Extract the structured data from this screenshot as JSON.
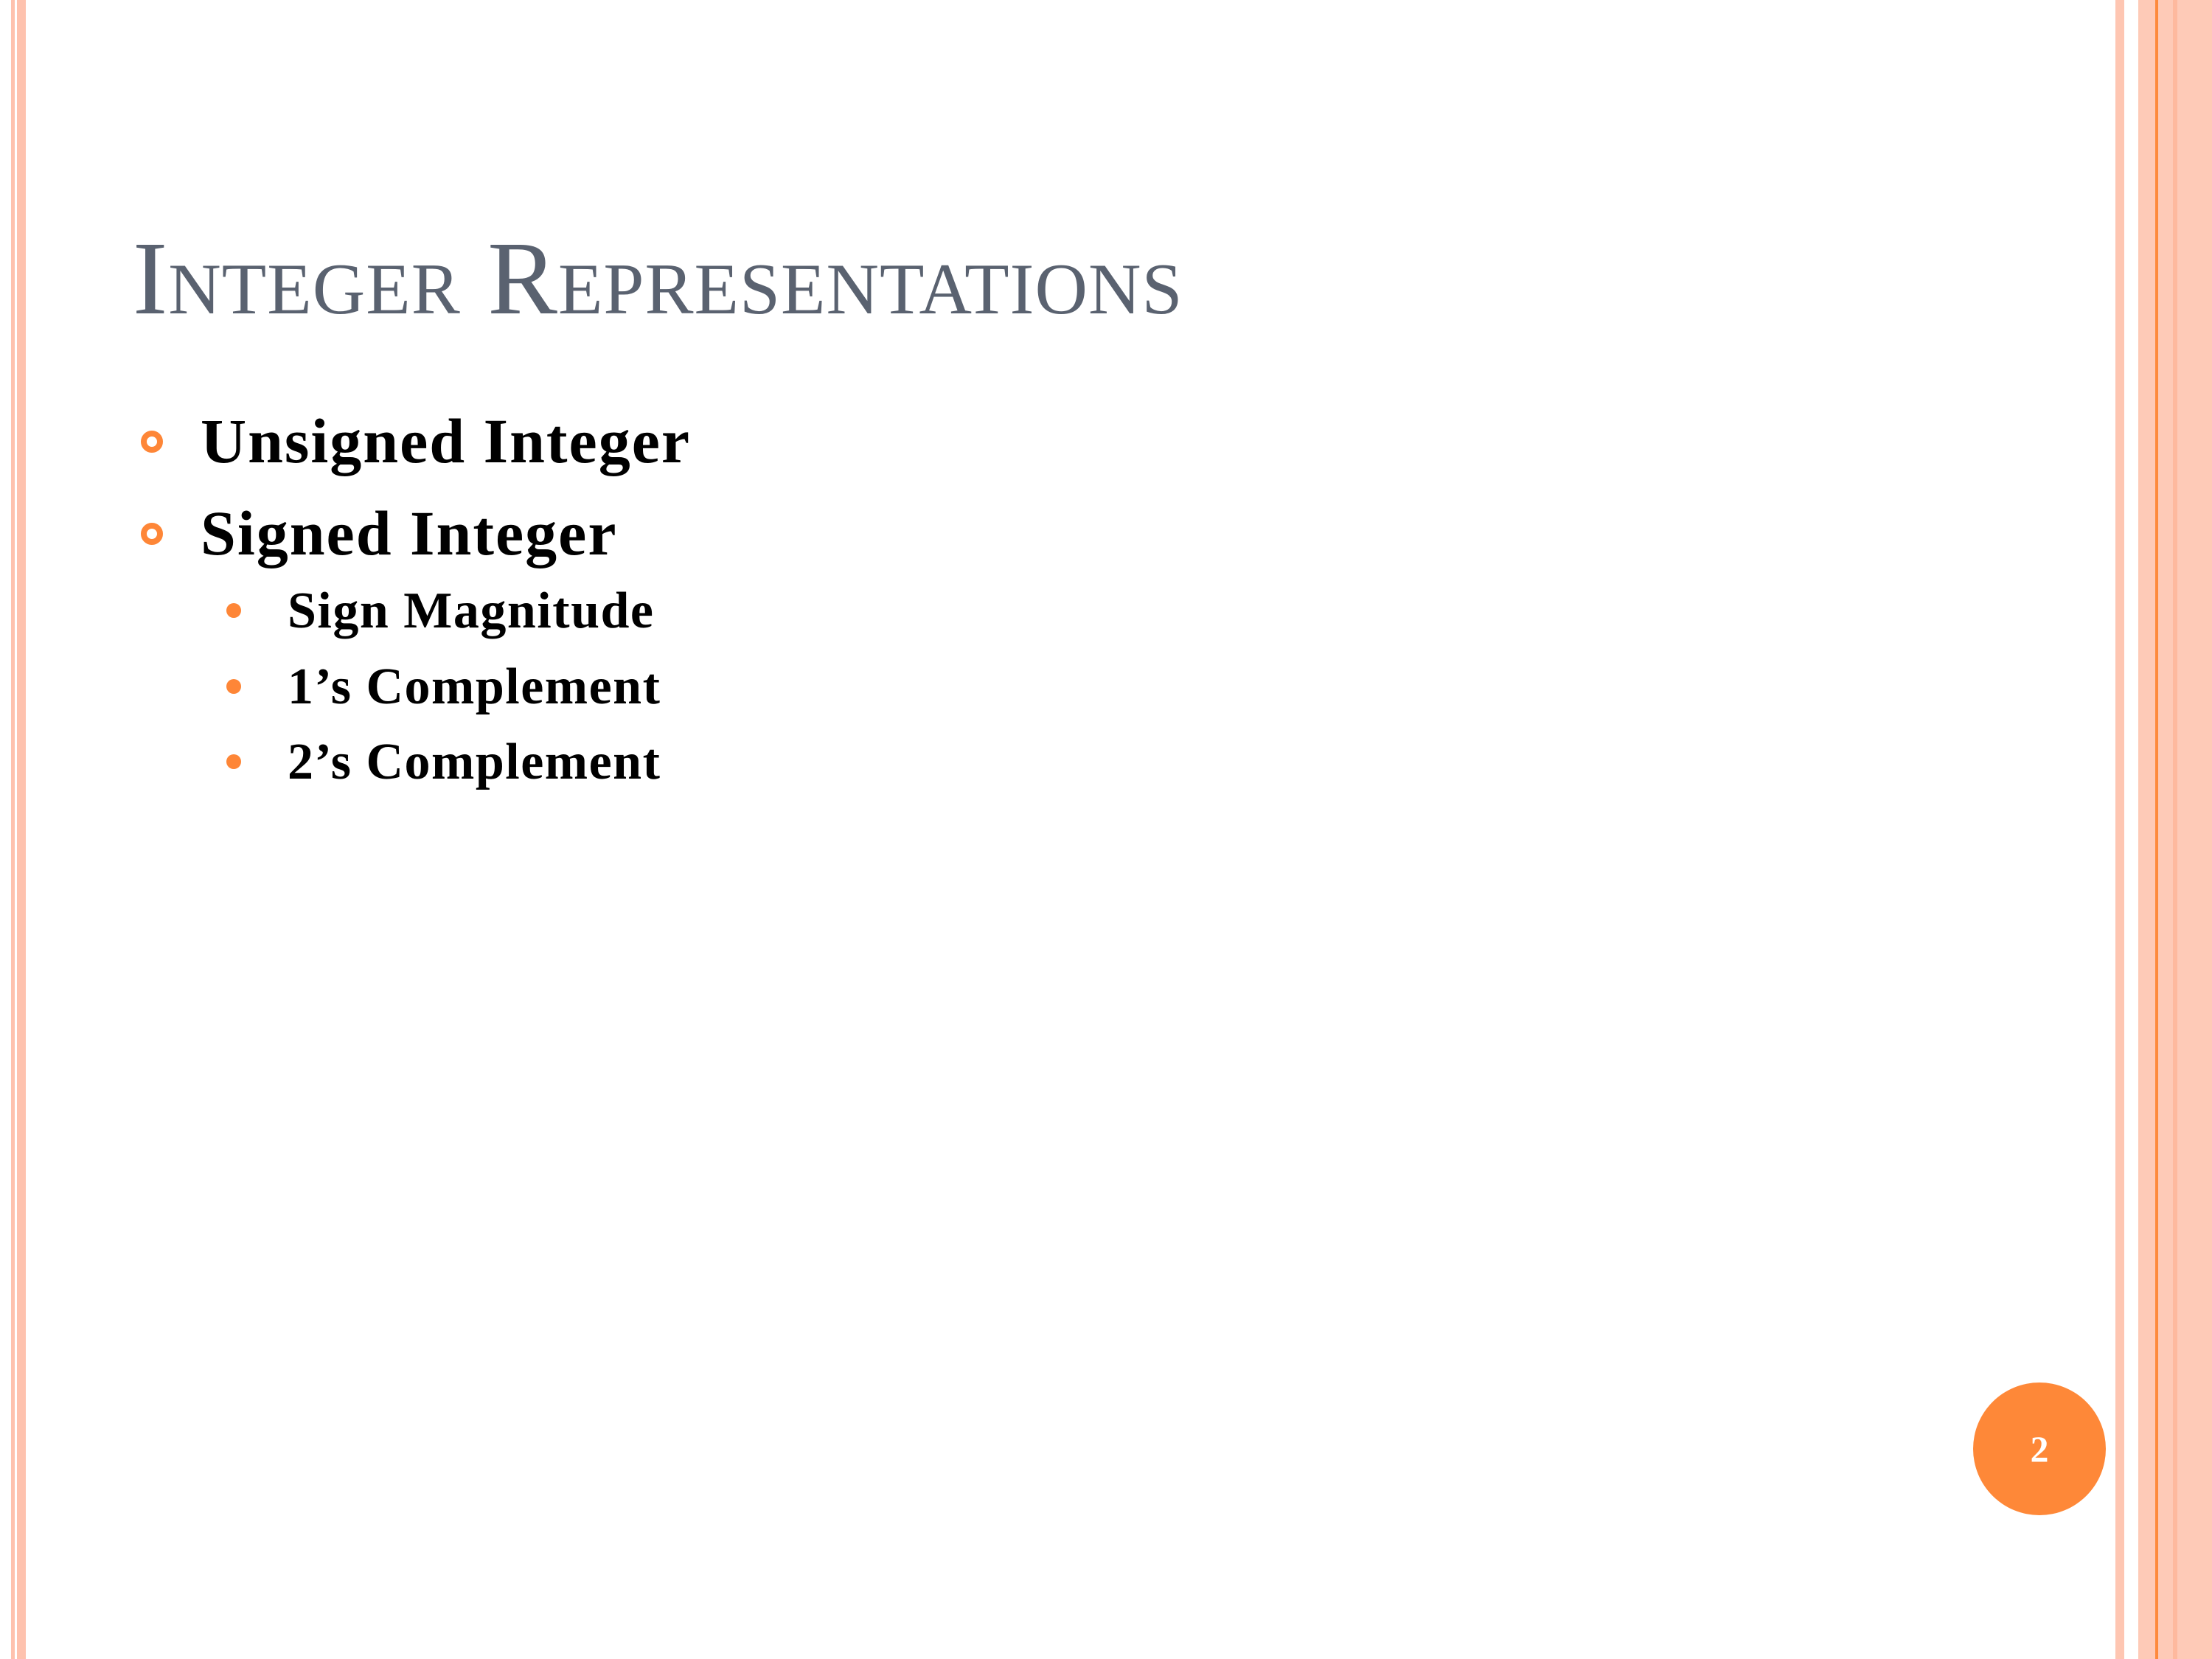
{
  "slide": {
    "title": "Integer Representations",
    "bullets": [
      {
        "text": "Unsigned Integer"
      },
      {
        "text": "Signed Integer",
        "children": [
          {
            "text": "Sign Magnitude"
          },
          {
            "text": "1’s Complement"
          },
          {
            "text": "2’s Complement"
          }
        ]
      }
    ],
    "page_number": "2"
  },
  "colors": {
    "accent": "#fe8637",
    "border_peach": "#fec8b4",
    "title": "#5a6270"
  }
}
